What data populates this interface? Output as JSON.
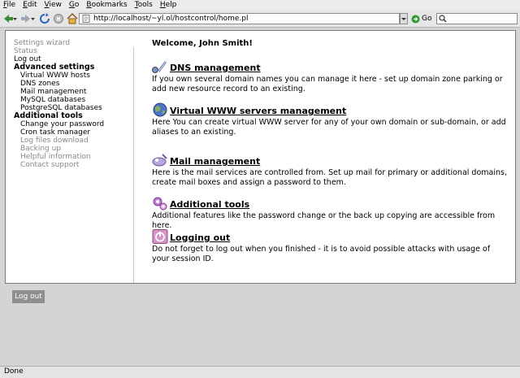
{
  "menu": [
    {
      "ul": "F",
      "rest": "ile"
    },
    {
      "ul": "E",
      "rest": "dit"
    },
    {
      "ul": "V",
      "rest": "iew"
    },
    {
      "ul": "G",
      "rest": "o"
    },
    {
      "ul": "B",
      "rest": "ookmarks"
    },
    {
      "ul": "T",
      "rest": "ools"
    },
    {
      "ul": "H",
      "rest": "elp"
    }
  ],
  "toolbar": {
    "url": "http://localhost/~yl.ol/hostcontrol/home.pl",
    "go_label": "Go"
  },
  "sidebar": {
    "items": [
      {
        "label": "Settings wizard",
        "type": "gray"
      },
      {
        "label": "Status",
        "type": "gray"
      },
      {
        "label": "Log out",
        "type": "blk"
      },
      {
        "label": "Advanced settings",
        "type": "head"
      },
      {
        "label": "Virtual WWW hosts",
        "type": "sub"
      },
      {
        "label": "DNS zones",
        "type": "sub"
      },
      {
        "label": "Mail management",
        "type": "sub"
      },
      {
        "label": "MySQL databases",
        "type": "sub"
      },
      {
        "label": "PostgreSQL databases",
        "type": "sub"
      },
      {
        "label": "Additional tools",
        "type": "head"
      },
      {
        "label": "Change your password",
        "type": "sub"
      },
      {
        "label": "Cron task manager",
        "type": "sub"
      },
      {
        "label": "Log files download",
        "type": "subgray"
      },
      {
        "label": "Backing up",
        "type": "subgray"
      },
      {
        "label": "Helpful information",
        "type": "subgray"
      },
      {
        "label": "Contact support",
        "type": "subgray"
      }
    ]
  },
  "main": {
    "welcome": "Welcome, John Smith!",
    "sections": [
      {
        "title": "DNS management",
        "icon": "dns-icon",
        "desc": "If you own several domain names you can manage it here - set up domain zone parking or add new resource record to an existing."
      },
      {
        "title": "Virtual WWW servers management",
        "icon": "globe-icon",
        "desc": "Here You can create virtual WWW server for any of your own domain or sub-domain, or add aliases to an existing."
      },
      {
        "title": "Mail management",
        "icon": "mail-icon",
        "desc": "Here is the mail services are controlled from. Set up mail for primary or additional domains, create mail boxes and assign a password to them."
      },
      {
        "title": "Additional tools",
        "icon": "tools-icon",
        "desc": "Additional features like the password change or the back up copying are accessible from here."
      },
      {
        "title": "Logging out",
        "icon": "power-icon",
        "desc": "Do not forget to log out when you finished - it is to avoid possible attacks with usage of your session ID."
      }
    ]
  },
  "logout_button": "Log out",
  "status": "Done"
}
